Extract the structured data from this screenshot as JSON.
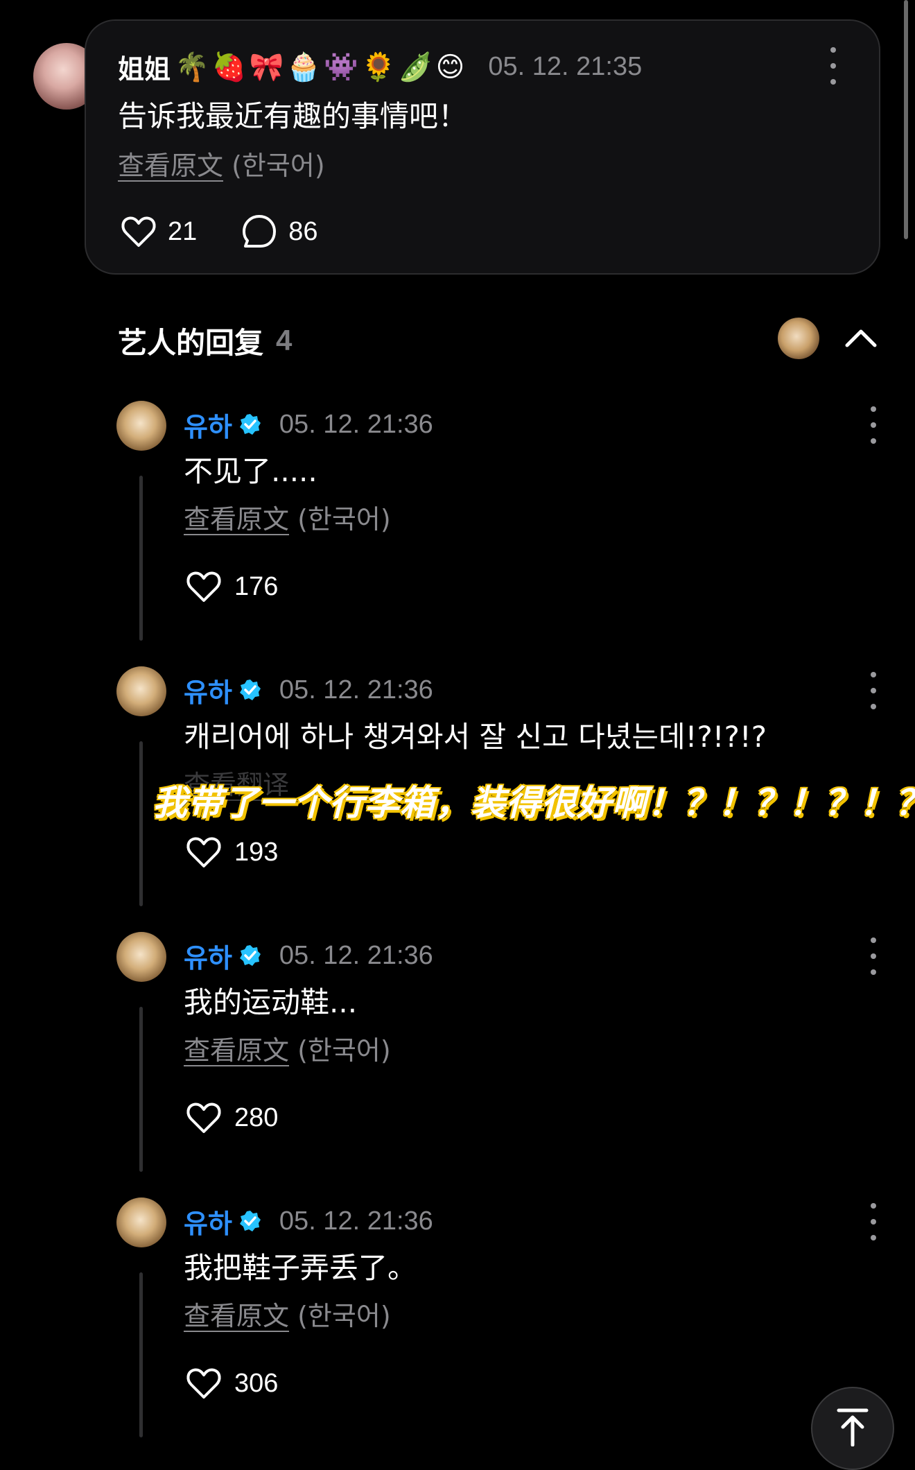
{
  "post": {
    "author": "姐姐",
    "emojis": "🌴🍓🎀🧁👾🌻🫛😊",
    "date": "05. 12. 21:35",
    "text": "告诉我最近有趣的事情吧！",
    "translate_link": "查看原文",
    "translate_lang": "(한국어)",
    "likes": "21",
    "comments": "86"
  },
  "replies_section": {
    "title": "艺人的回复",
    "count": "4"
  },
  "replies": [
    {
      "name": "유하",
      "date": "05. 12. 21:36",
      "text": "不见了.....",
      "translate_link": "查看原文",
      "translate_lang": "(한국어)",
      "likes": "176"
    },
    {
      "name": "유하",
      "date": "05. 12. 21:36",
      "text": "캐리어에 하나 챙겨와서 잘 신고 다녔는데!?!?!?",
      "translate_link": "查看翻译",
      "translate_lang": "",
      "likes": "193"
    },
    {
      "name": "유하",
      "date": "05. 12. 21:36",
      "text": "我的运动鞋...",
      "translate_link": "查看原文",
      "translate_lang": "(한국어)",
      "likes": "280"
    },
    {
      "name": "유하",
      "date": "05. 12. 21:36",
      "text": "我把鞋子弄丢了。",
      "translate_link": "查看原文",
      "translate_lang": "(한국어)",
      "likes": "306"
    }
  ],
  "caption": "我带了一个行李箱，装得很好啊！？！？！？！？",
  "colors": {
    "background": "#000000",
    "card": "#111113",
    "artist_name": "#2e90ff",
    "verified": "#27c3ff",
    "muted": "#8a8a8e",
    "caption_outline": "#f2c200"
  }
}
